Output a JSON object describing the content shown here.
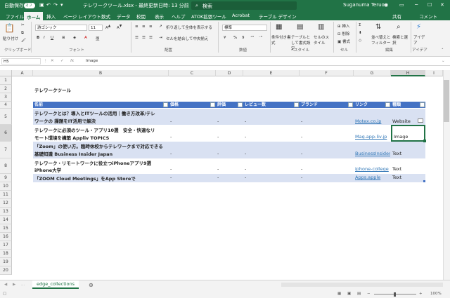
{
  "titlebar": {
    "autosave": "自動保存",
    "autosave_state": "オフ",
    "filename": "テレワークツール.xlsx  -  最終更新日時: 13 分前",
    "search": "検索",
    "user": "Suganuma Teruo"
  },
  "tabs": [
    "ファイル",
    "ホーム",
    "挿入",
    "ページ レイアウト",
    "数式",
    "データ",
    "校閲",
    "表示",
    "ヘルプ",
    "ATOK拡張ツール",
    "Acrobat",
    "テーブル デザイン"
  ],
  "share": "共有",
  "comment": "コメント",
  "ribbon": {
    "paste": "貼り付け",
    "font_name": "游ゴシック",
    "font_size": "11",
    "wrap": "折り返して全体を表示する",
    "merge": "セルを結合して中央揃え",
    "num_format": "標準",
    "cond_format": "条件付き書式",
    "table_format": "テーブルとして書式設定",
    "cell_style": "セルのスタイル",
    "insert": "挿入",
    "delete": "削除",
    "format": "書式",
    "sort": "並べ替えとフィルター",
    "find": "検索と選択",
    "ideas": "アイデア",
    "groups": [
      "クリップボード",
      "フォント",
      "配置",
      "数値",
      "スタイル",
      "セル",
      "編集",
      "アイデア"
    ]
  },
  "formula": {
    "namebox": "H5",
    "value": "Image",
    "fx": "fx"
  },
  "columns": [
    "A",
    "B",
    "C",
    "D",
    "E",
    "F",
    "G",
    "H",
    "I"
  ],
  "rows": [
    "1",
    "2",
    "3",
    "4",
    "5",
    "6",
    "7",
    "8",
    "9",
    "10",
    "11",
    "12",
    "13",
    "14",
    "15",
    "16",
    "17",
    "18",
    "19",
    "20"
  ],
  "sheet": {
    "title": "テレワークツール",
    "headers": [
      "名前",
      "価格",
      "評価",
      "レビュー数",
      "ブランド",
      "リンク",
      "種類"
    ],
    "records": [
      {
        "name1": "テレワークとは？導入とITツールの活用｜働き方改革/テレ",
        "name2": "ワークの 課題をIT活用で解決",
        "price": "-",
        "rating": "-",
        "reviews": "-",
        "brand": "-",
        "link": "Motex.co.jp",
        "type": "Website"
      },
      {
        "name1": "テレワークに必須のツール・アプリ10選　安全・快適なリ",
        "name2": "モート環境を構築  Appliv TOPICS",
        "price": "-",
        "rating": "-",
        "reviews": "-",
        "brand": "-",
        "link": "Mag.app-liv.jp",
        "type": "Image"
      },
      {
        "name1": "「Zoom」の使い方。臨時休校からテレワークまで対応できる",
        "name2": "基礎知識   Business Insider Japan",
        "price": "-",
        "rating": "-",
        "reviews": "-",
        "brand": "-",
        "link": "BusinessInsider",
        "type": "Text"
      },
      {
        "name1": "テレワーク・リモートワークに役立つiPhoneアプリ9選",
        "name2": "iPhone大学",
        "price": "-",
        "rating": "-",
        "reviews": "-",
        "brand": "-",
        "link": "iphone-college",
        "type": "Text"
      },
      {
        "name1": "「ZOOM Cloud Meetings」をApp Storeで",
        "name2": "",
        "price": "-",
        "rating": "-",
        "reviews": "-",
        "brand": "-",
        "link": "Apps.apple",
        "type": "Text"
      }
    ]
  },
  "sheet_tab": "edge_collections",
  "status": {
    "zoom": "100%"
  },
  "colors": {
    "brand": "#217346",
    "table_header": "#4472c4",
    "band": "#d9e1f2",
    "link": "#2e75b6"
  }
}
